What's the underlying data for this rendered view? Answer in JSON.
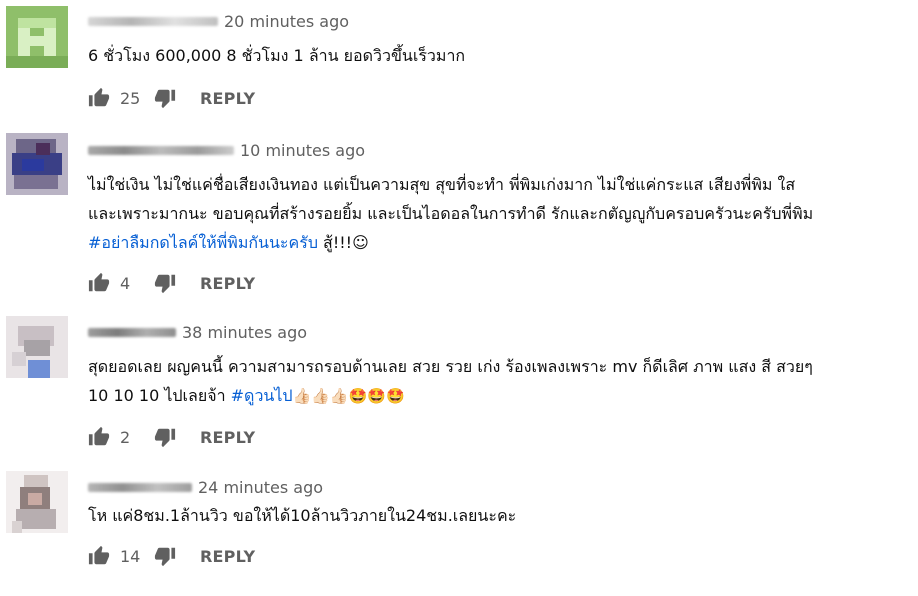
{
  "reply_label": "REPLY",
  "comments": [
    {
      "time": "20 minutes ago",
      "lines": [
        "6 ชั่วโมง 600,000 8 ชั่วโมง 1 ล้าน ยอดวิวขึ้นเร็วมาก"
      ],
      "likes": "25"
    },
    {
      "time": "10 minutes ago",
      "lines": [
        "ไม่ใช่เงิน ไม่ใช่แค่ชื่อเสียงเงินทอง แต่เป็นความสุข สุขที่จะทำ พี่พิมเก่งมาก ไม่ใช่แค่กระแส เสียงพี่พิม ใส",
        "และเพราะมากนะ ขอบคุณที่สร้างรอยยิ้ม และเป็นไอดอลในการทำดี รักและกตัญญูกับครอบครัวนะครับพี่พิม"
      ],
      "hashtag": "#อย่าลืมกดไลค์ให้พี่พิมกันนะครับ",
      "hashtag_suffix": " สู้!!!☺",
      "likes": "4"
    },
    {
      "time": "38 minutes ago",
      "lines": [
        "สุดยอดเลย ผญคนนี้ ความสามารถรอบด้านเลย สวย รวย เก่ง ร้องเพลงเพราะ mv ก็ดีเลิศ ภาพ แสง สี สวยๆ",
        "10 10 10 ไปเลยจ้า"
      ],
      "hashtag": "#ดูวนไป",
      "emojis": "👍🏻👍🏻👍🏻🤩🤩🤩",
      "likes": "2"
    },
    {
      "time": "24 minutes ago",
      "lines": [
        "โห แค่8ชม.1ล้านวิว ขอให้ได้10ล้านวิวภายใน24ชม.เลยนะคะ"
      ],
      "likes": "14"
    }
  ]
}
